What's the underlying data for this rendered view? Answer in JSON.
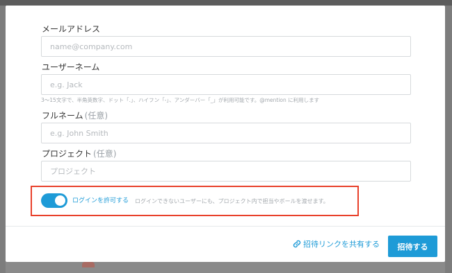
{
  "form": {
    "email": {
      "label": "メールアドレス",
      "placeholder": "name@company.com",
      "value": ""
    },
    "username": {
      "label": "ユーザーネーム",
      "placeholder": "e.g. Jack",
      "value": "",
      "hint": "3～15文字で、半角英数字、ドット「.」、ハイフン「-」、アンダーバー「_」が利用可能です。@mention に利用します"
    },
    "fullname": {
      "label": "フルネーム",
      "optional": "(任意)",
      "placeholder": "e.g. John Smith",
      "value": ""
    },
    "project": {
      "label": "プロジェクト",
      "optional": "(任意)",
      "placeholder": "プロジェクト",
      "value": ""
    },
    "login_toggle": {
      "label": "ログインを許可する",
      "description": "ログインできないユーザーにも、プロジェクト内で担当やボールを渡せます。",
      "enabled": true
    }
  },
  "footer": {
    "share_link_label": "招待リンクを共有する",
    "invite_button_label": "招待する"
  },
  "colors": {
    "accent": "#1e9bd7",
    "highlight_border": "#e8402a",
    "overlay": "#8a8a8a"
  },
  "icons": {
    "share_link": "link-icon"
  }
}
